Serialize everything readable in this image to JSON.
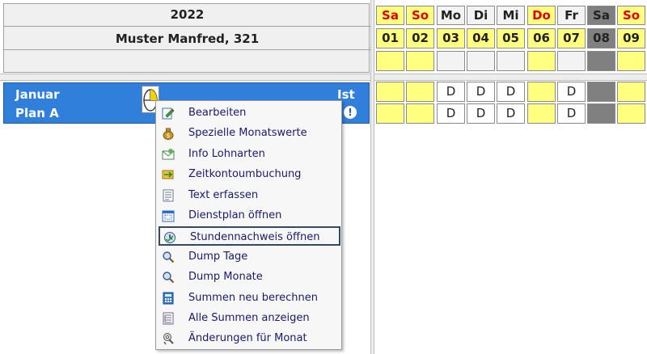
{
  "header": {
    "year": "2022",
    "employee": "Muster Manfred, 321"
  },
  "month_row": {
    "month": "Januar",
    "plan": "Plan A",
    "ist": "Ist",
    "info": "!"
  },
  "calendar": {
    "days": [
      {
        "wd": "Sa",
        "num": "01",
        "type": "weekend"
      },
      {
        "wd": "So",
        "num": "02",
        "type": "weekend"
      },
      {
        "wd": "Mo",
        "num": "03",
        "type": "work"
      },
      {
        "wd": "Di",
        "num": "04",
        "type": "work"
      },
      {
        "wd": "Mi",
        "num": "05",
        "type": "work"
      },
      {
        "wd": "Do",
        "num": "06",
        "type": "holiday"
      },
      {
        "wd": "Fr",
        "num": "07",
        "type": "work"
      },
      {
        "wd": "Sa",
        "num": "08",
        "type": "selected"
      },
      {
        "wd": "So",
        "num": "09",
        "type": "weekend"
      }
    ],
    "row1": [
      "",
      "",
      "D",
      "D",
      "D",
      "",
      "D",
      "",
      ""
    ],
    "row2": [
      "",
      "",
      "D",
      "D",
      "D",
      "",
      "D",
      "",
      ""
    ]
  },
  "menu": {
    "items": [
      {
        "label": "Bearbeiten",
        "icon": "edit-icon"
      },
      {
        "label": "Spezielle Monatswerte",
        "icon": "money-bag-icon"
      },
      {
        "label": "Info Lohnarten",
        "icon": "mail-icon"
      },
      {
        "label": "Zeitkontoumbuchung",
        "icon": "transfer-icon"
      },
      {
        "label": "Text erfassen",
        "icon": "text-icon"
      },
      {
        "label": "Dienstplan öffnen",
        "icon": "schedule-icon"
      },
      {
        "label": "Stundennachweis öffnen",
        "icon": "clock-icon",
        "highlighted": true
      },
      {
        "label": "Dump Tage",
        "icon": "magnifier-icon"
      },
      {
        "label": "Dump Monate",
        "icon": "magnifier-icon"
      },
      {
        "label": "Summen neu berechnen",
        "icon": "calculator-icon"
      },
      {
        "label": "Alle Summen anzeigen",
        "icon": "list-icon"
      },
      {
        "label": "Änderungen für Monat",
        "icon": "settings-icon"
      }
    ]
  }
}
